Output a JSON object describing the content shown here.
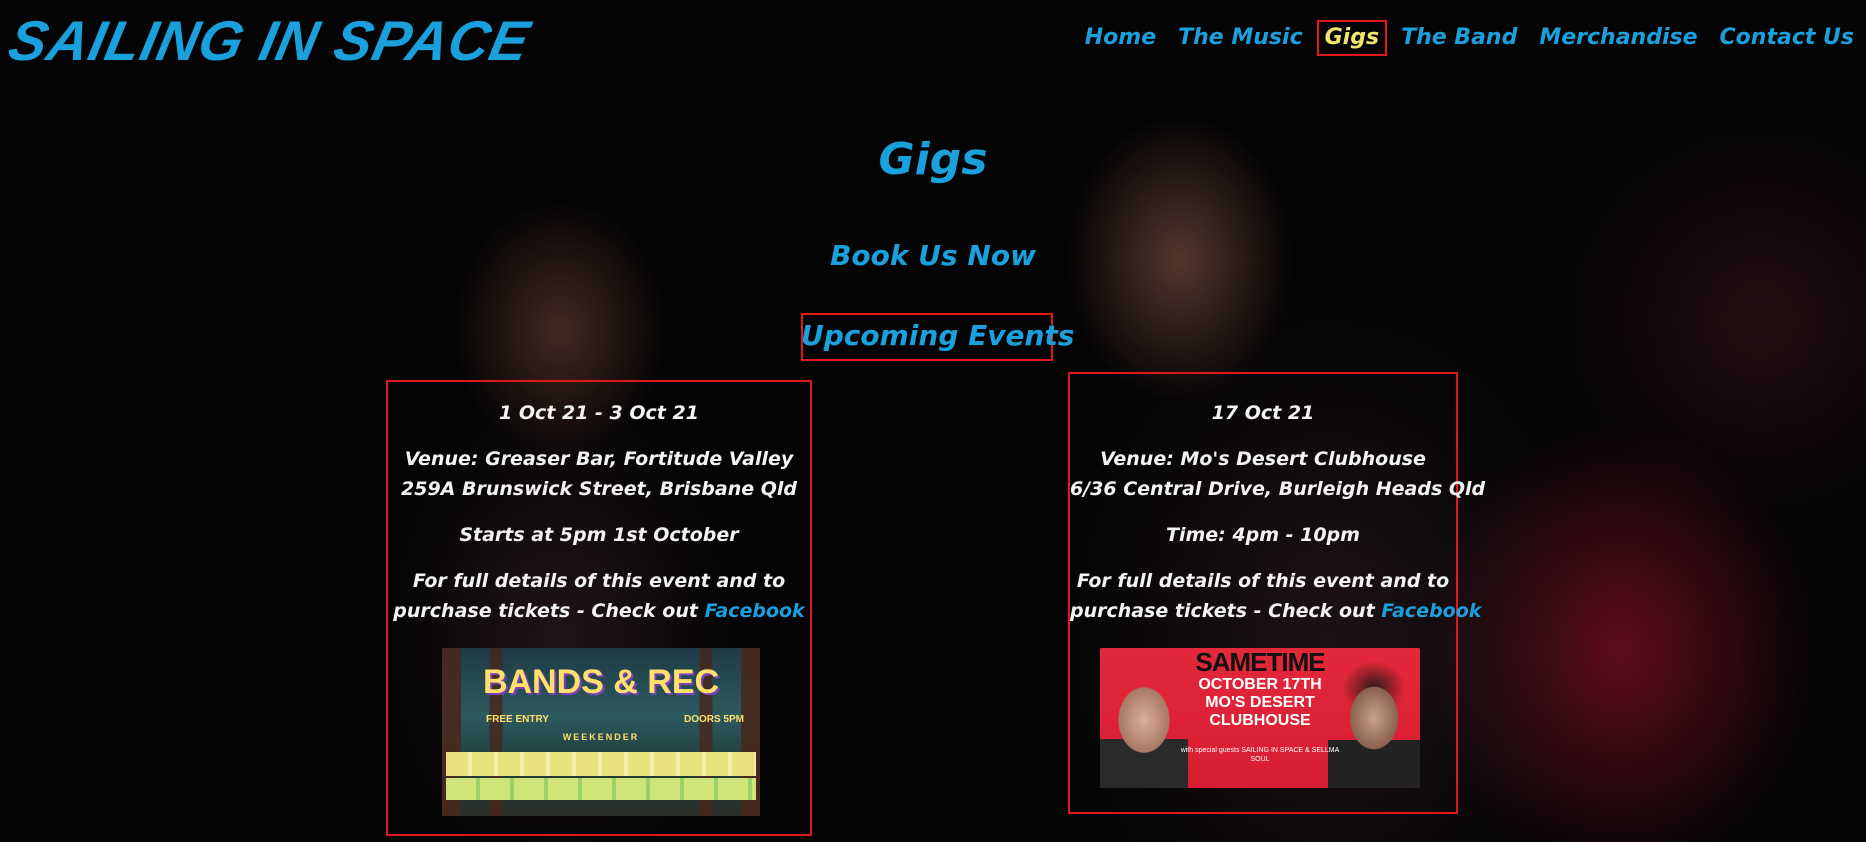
{
  "site": {
    "logo": "SAILING IN SPACE"
  },
  "nav": {
    "items": [
      {
        "label": "Home"
      },
      {
        "label": "The Music"
      },
      {
        "label": "Gigs",
        "active": true
      },
      {
        "label": "The Band"
      },
      {
        "label": "Merchandise"
      },
      {
        "label": "Contact Us"
      }
    ]
  },
  "page": {
    "title": "Gigs",
    "book_link": "Book Us Now",
    "upcoming_heading": "Upcoming Events"
  },
  "events": [
    {
      "date": "1 Oct 21 - 3 Oct 21",
      "venue": "Venue: Greaser Bar, Fortitude Valley",
      "address": "259A Brunswick Street, Brisbane Qld",
      "time": "Starts at 5pm 1st October",
      "details_line1": "For full details of this event and to",
      "details_line2": "purchase tickets - Check out",
      "link_label": "Facebook",
      "poster": {
        "title": "BANDS & REC",
        "subtitle": "WEEKENDER",
        "left_tag": "FREE ENTRY",
        "right_tag": "DOORS 5PM"
      }
    },
    {
      "date": "17 Oct 21",
      "venue": "Venue: Mo's Desert Clubhouse",
      "address": "6/36 Central Drive, Burleigh Heads Qld",
      "time": "Time: 4pm - 10pm",
      "details_line1": "For full details of this event and to",
      "details_line2": "purchase tickets - Check out",
      "link_label": "Facebook",
      "poster": {
        "title": "SAMETIME",
        "date_line1": "OCTOBER 17TH",
        "date_line2": "MO'S DESERT",
        "date_line3": "CLUBHOUSE",
        "guests": "with special guests SAILING IN SPACE & SELLMA SOUL"
      }
    }
  ],
  "colors": {
    "accent": "#1aa0dc",
    "active_nav": "#f2e56b",
    "outline": "#e01818",
    "text": "#f3f3f3"
  }
}
